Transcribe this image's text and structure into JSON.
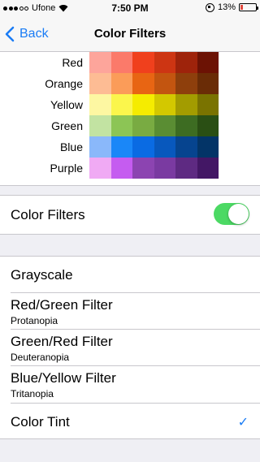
{
  "status": {
    "carrier": "Ufone",
    "time": "7:50 PM",
    "battery": "13%"
  },
  "nav": {
    "back_label": "Back",
    "title": "Color Filters"
  },
  "swatches": [
    {
      "label": "Red",
      "colors": [
        "#fda59b",
        "#fb7a6a",
        "#f0401d",
        "#cd3513",
        "#9e230b",
        "#6c1204"
      ]
    },
    {
      "label": "Orange",
      "colors": [
        "#fdbc94",
        "#fb9c59",
        "#e86513",
        "#c35510",
        "#8e3f0c",
        "#6a2c06"
      ]
    },
    {
      "label": "Yellow",
      "colors": [
        "#fdf7a2",
        "#fbf64c",
        "#f5ec00",
        "#d3c800",
        "#a39c00",
        "#7a7300"
      ]
    },
    {
      "label": "Green",
      "colors": [
        "#c2e3a2",
        "#8cc555",
        "#79ab42",
        "#5a8d33",
        "#3d6c22",
        "#2a4f14"
      ]
    },
    {
      "label": "Blue",
      "colors": [
        "#8ab8fa",
        "#1a87f8",
        "#0a6be3",
        "#0858bd",
        "#06448f",
        "#033467"
      ]
    },
    {
      "label": "Purple",
      "colors": [
        "#f0aaf4",
        "#c55cf0",
        "#8c44b1",
        "#7a3aa1",
        "#5e2a82",
        "#431765"
      ]
    }
  ],
  "toggle": {
    "label": "Color Filters",
    "on": true
  },
  "filters": [
    {
      "title": "Grayscale",
      "subtitle": "",
      "checked": false
    },
    {
      "title": "Red/Green Filter",
      "subtitle": "Protanopia",
      "checked": false
    },
    {
      "title": "Green/Red Filter",
      "subtitle": "Deuteranopia",
      "checked": false
    },
    {
      "title": "Blue/Yellow Filter",
      "subtitle": "Tritanopia",
      "checked": false
    },
    {
      "title": "Color Tint",
      "subtitle": "",
      "checked": true
    }
  ],
  "check_mark": "✓"
}
